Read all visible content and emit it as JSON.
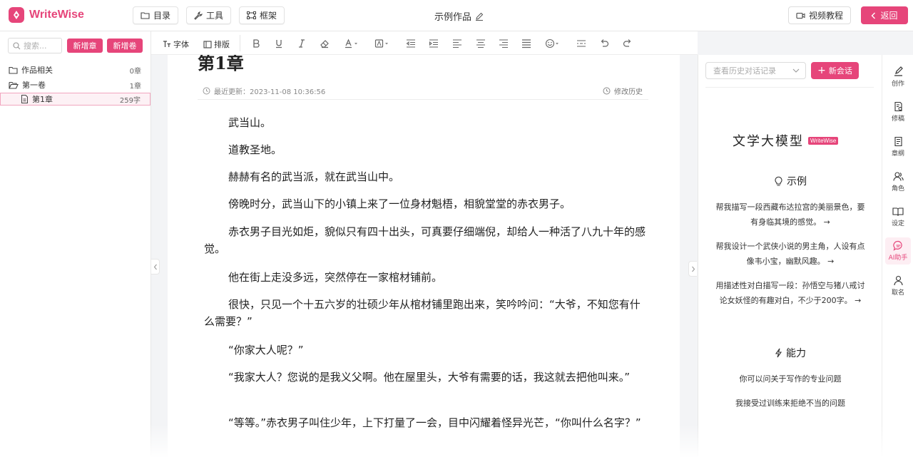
{
  "app": {
    "name": "WriteWise",
    "document_title": "示例作品"
  },
  "topbar": {
    "catalog_label": "目录",
    "tools_label": "工具",
    "frame_label": "框架",
    "video_tutorial_label": "视频教程",
    "back_label": "返回"
  },
  "sidebar": {
    "search_placeholder": "搜索...",
    "new_chapter_label": "新增章",
    "new_volume_label": "新增卷",
    "items": [
      {
        "label": "作品相关",
        "count": "0章",
        "icon": "folder-icon"
      },
      {
        "label": "第一卷",
        "count": "1章",
        "icon": "folder-open-icon"
      },
      {
        "label": "第1章",
        "count": "259字",
        "icon": "document-icon",
        "selected": true
      }
    ]
  },
  "format_toolbar": {
    "font_label": "字体",
    "layout_label": "排版",
    "icons": [
      "bold-icon",
      "underline-icon",
      "italic-icon",
      "eraser-icon",
      "font-color-icon",
      "highlight-icon",
      "indent-decrease-icon",
      "indent-increase-icon",
      "align-left-icon",
      "align-center-icon",
      "align-right-icon",
      "align-justify-icon",
      "emoji-icon",
      "divider-icon",
      "undo-icon",
      "redo-icon"
    ]
  },
  "editor": {
    "chapter_title": "第1章",
    "last_updated": "最近更新：2023-11-08 10:36:56",
    "history_label": "修改历史",
    "paragraphs": [
      "武当山。",
      "道教圣地。",
      "赫赫有名的武当派，就在武当山中。",
      "傍晚时分，武当山下的小镇上来了一位身材魁梧，相貌堂堂的赤衣男子。",
      "赤衣男子目光如炬，貌似只有四十出头，可真要仔细端倪，却给人一种活了八九十年的感觉。",
      "他在街上走没多远，突然停在一家棺材铺前。",
      "很快，只见一个十五六岁的壮硕少年从棺材铺里跑出来，笑吟吟问：“大爷，不知您有什么需要？”",
      "“你家大人呢？”",
      "“我家大人？您说的是我义父啊。他在屋里头，大爷有需要的话，我这就去把他叫来。”",
      "“等等。”赤衣男子叫住少年，上下打量了一会，目中闪耀着怪异光芒，“你叫什么名字？”"
    ]
  },
  "ai_panel": {
    "history_placeholder": "查看历史对话记录",
    "new_chat_label": "新会话",
    "model_title": "文学大模型",
    "badge": "WriteWise",
    "examples_heading": "示例",
    "examples": [
      "帮我描写一段西藏布达拉宫的美丽景色，要有身临其境的感觉。",
      "帮我设计一个武侠小说的男主角，人设有点像韦小宝，幽默风趣。",
      "用描述性对白描写一段：孙悟空与猪八戒讨论女妖怪的有趣对白，不少于200字。"
    ],
    "capability_heading": "能力",
    "capabilities": [
      "你可以问关于写作的专业问题",
      "我接受过训练来拒绝不当的问题"
    ]
  },
  "rail": {
    "items": [
      {
        "label": "创作",
        "icon": "pen-icon"
      },
      {
        "label": "修稿",
        "icon": "revise-icon"
      },
      {
        "label": "章纲",
        "icon": "outline-icon"
      },
      {
        "label": "角色",
        "icon": "character-icon"
      },
      {
        "label": "设定",
        "icon": "book-icon"
      },
      {
        "label": "AI助手",
        "icon": "chat-icon",
        "active": true
      },
      {
        "label": "取名",
        "icon": "name-icon"
      }
    ]
  },
  "colors": {
    "accent": "#e6457a",
    "accent_light": "#fdeef3"
  }
}
